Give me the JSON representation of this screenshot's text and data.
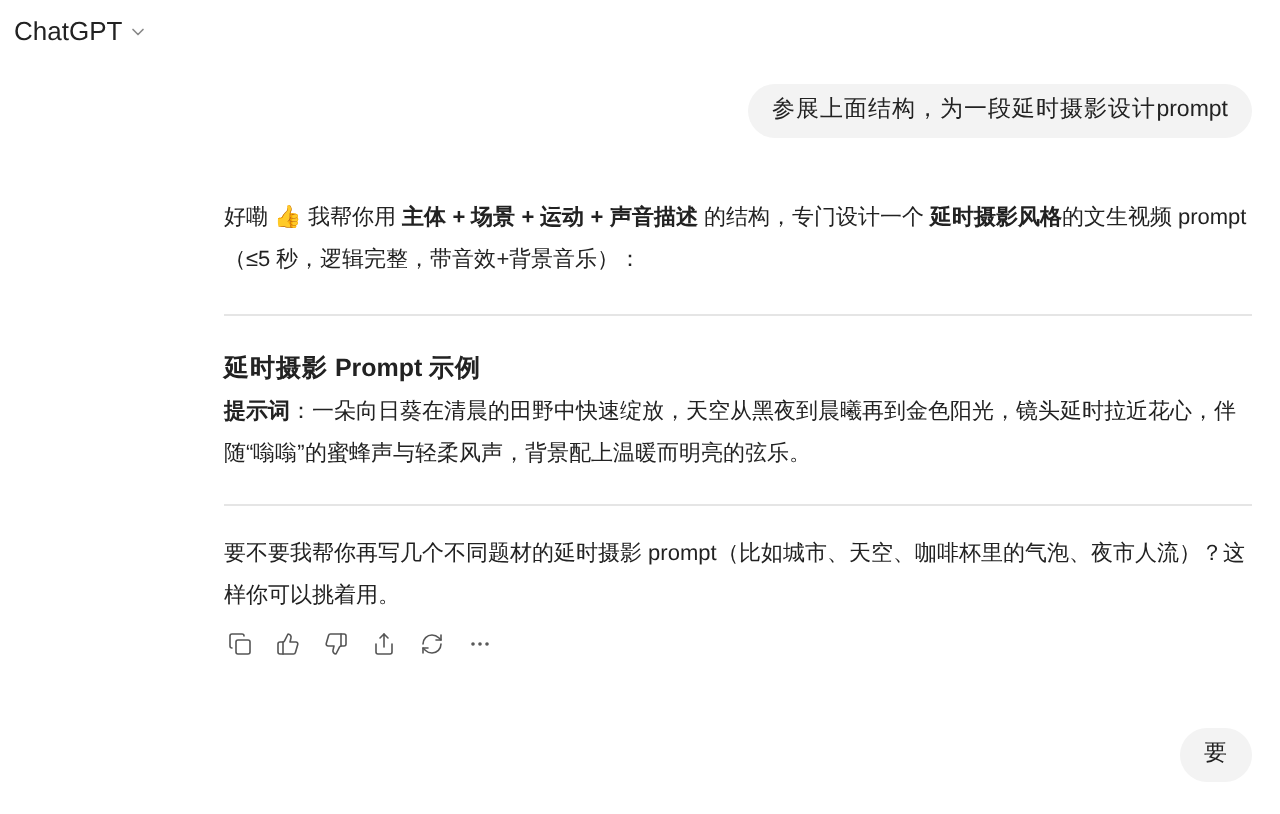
{
  "header": {
    "title": "ChatGPT"
  },
  "messages": [
    {
      "kind": "user",
      "text": "参展上面结构，为一段延时摄影设计prompt"
    },
    {
      "kind": "assistant",
      "intro": "好嘞 👍 我帮你用 **主体 + 场景 + 运动 + 声音描述** 的结构，专门设计一个 **延时摄影风格**的文生视频 prompt（≤5 秒，逻辑完整，带音效+背景音乐）：",
      "section_title": "延时摄影 Prompt 示例",
      "prompt": "**提示词**：一朵向日葵在清晨的田野中快速绽放，天空从黑夜到晨曦再到金色阳光，镜头延时拉近花心，伴随“嗡嗡”的蜜蜂声与轻柔风声，背景配上温暖而明亮的弦乐。",
      "followup": "要不要我帮你再写几个不同题材的延时摄影 prompt（比如城市、天空、咖啡杯里的气泡、夜市人流）？这样你可以挑着用。"
    },
    {
      "kind": "user",
      "text": "要"
    }
  ]
}
